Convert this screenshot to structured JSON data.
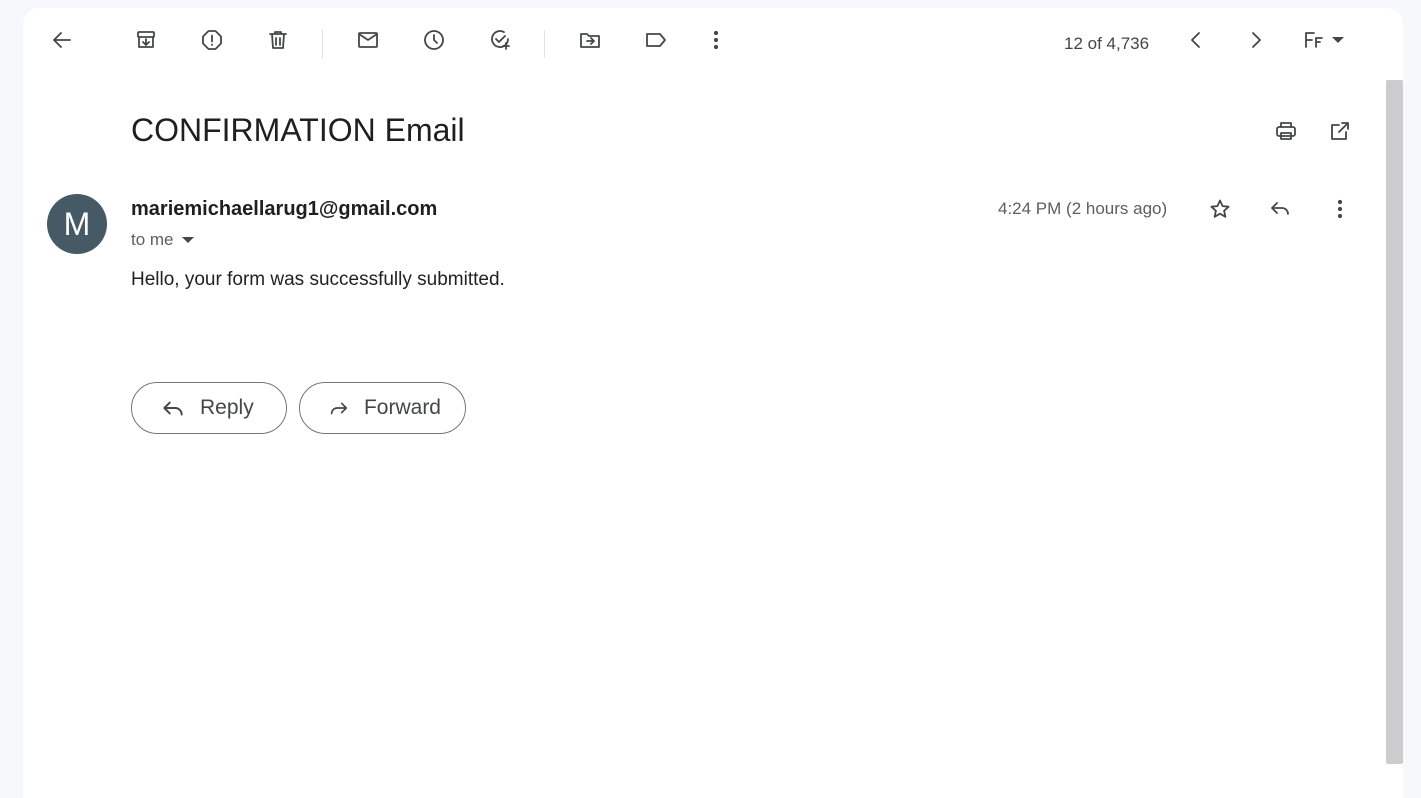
{
  "toolbar": {
    "counter": "12 of 4,736",
    "icons": [
      "back-arrow-icon",
      "archive-icon",
      "report-spam-icon",
      "delete-icon",
      "mark-unread-icon",
      "snooze-icon",
      "add-task-icon",
      "move-to-icon",
      "label-icon",
      "more-vert-icon",
      "chevron-left-icon",
      "chevron-right-icon",
      "font-icon",
      "caret-down-icon"
    ]
  },
  "email": {
    "subject": "CONFIRMATION Email",
    "avatar_letter": "M",
    "sender": "mariemichaellarug1@gmail.com",
    "recipient": "to me",
    "time": "4:24 PM (2 hours ago)",
    "body": "Hello, your form was successfully submitted."
  },
  "actions": {
    "reply_label": "Reply",
    "forward_label": "Forward"
  },
  "colors": {
    "background": "#f6f8fc",
    "avatar": "#455a64",
    "icon": "#444746"
  }
}
